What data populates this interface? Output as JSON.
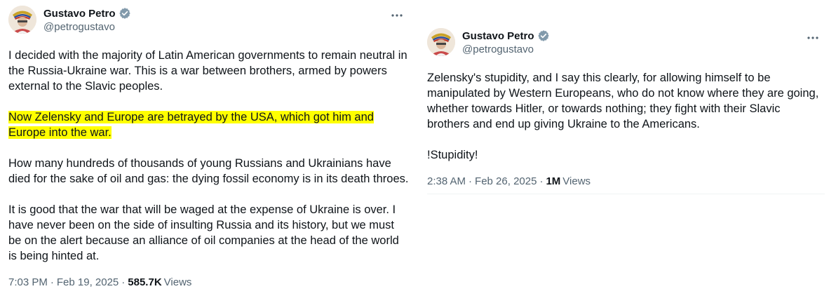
{
  "colors": {
    "text": "#0f1419",
    "secondary": "#536471",
    "verified_blue": "#1d9bf0",
    "highlight": "#ffff00"
  },
  "left_tweet": {
    "author": {
      "name": "Gustavo Petro",
      "handle": "@petrogustavo",
      "verified_icon": "verified-badge-icon"
    },
    "more_icon": "more-options-icon",
    "paragraphs": [
      "I decided with the majority of Latin American governments to remain neutral in the Russia-Ukraine war. This is a war between brothers, armed by powers external to the Slavic peoples.",
      "Now Zelensky and Europe are betrayed by the USA, which got him and Europe into the war.",
      "How many hundreds of thousands of young Russians and Ukrainians have died for the sake of oil and gas: the dying fossil economy is in its death throes.",
      "It is good that the war that will be waged at the expense of Ukraine is over. I have never been on the side of insulting Russia and its history, but we must be on the alert because an alliance of oil companies at the head of the world is being hinted at."
    ],
    "meta": {
      "time": "7:03 PM",
      "date": "Feb 19, 2025",
      "sep": "·",
      "views_count": "585.7K",
      "views_label": "Views"
    }
  },
  "right_tweet": {
    "author": {
      "name": "Gustavo Petro",
      "handle": "@petrogustavo",
      "verified_icon": "verified-badge-icon"
    },
    "more_icon": "more-options-icon",
    "paragraphs": [
      "Zelensky's stupidity, and I say this clearly, for allowing himself to be manipulated by Western Europeans, who do not know where they are going, whether towards Hitler, or towards nothing; they fight with their Slavic brothers and end up giving Ukraine to the Americans.",
      "!Stupidity!"
    ],
    "meta": {
      "time": "2:38 AM",
      "date": "Feb 26, 2025",
      "sep": "·",
      "views_count": "1M",
      "views_label": "Views"
    }
  }
}
